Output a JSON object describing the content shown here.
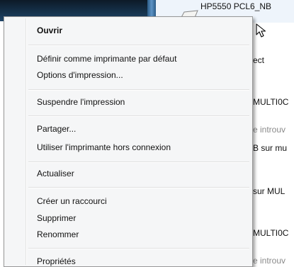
{
  "header": {
    "printer_name": "HP5550 PCL6_NB"
  },
  "background_rows": [
    {
      "text": "ect",
      "muted": false
    },
    {
      "text": "MULTI0C",
      "muted": false
    },
    {
      "text": "e introuv",
      "muted": true
    },
    {
      "text": "B sur mu",
      "muted": false
    },
    {
      "text": "sur MUL",
      "muted": false
    },
    {
      "text": "MULTI0C",
      "muted": false
    },
    {
      "text": "e introuv",
      "muted": true
    }
  ],
  "menu": {
    "open": "Ouvrir",
    "set_default": "Définir comme imprimante par défaut",
    "print_options": "Options d'impression...",
    "pause": "Suspendre l'impression",
    "share": "Partager...",
    "offline": "Utiliser l'imprimante hors connexion",
    "refresh": "Actualiser",
    "shortcut": "Créer un raccourci",
    "delete": "Supprimer",
    "rename": "Renommer",
    "properties": "Propriétés"
  },
  "icons": {
    "printer": "printer-icon",
    "cursor": "mouse-cursor-icon"
  }
}
